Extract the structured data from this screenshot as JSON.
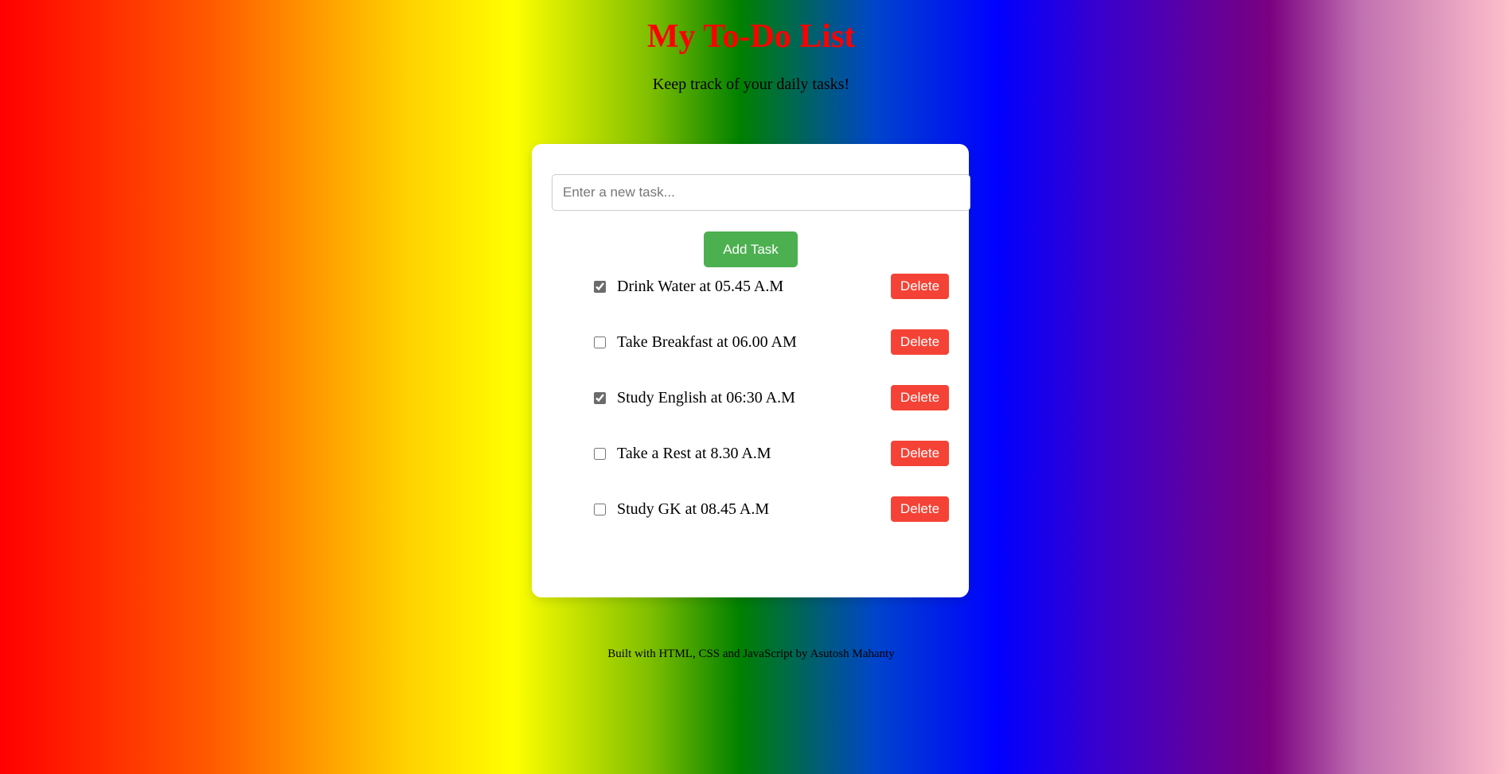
{
  "header": {
    "title": "My To-Do List",
    "subtitle": "Keep track of your daily tasks!"
  },
  "input": {
    "placeholder": "Enter a new task...",
    "value": ""
  },
  "add_button_label": "Add Task",
  "tasks": [
    {
      "text": "Drink Water at 05.45 A.M",
      "done": true,
      "delete_label": "Delete"
    },
    {
      "text": "Take Breakfast at 06.00 AM",
      "done": false,
      "delete_label": "Delete"
    },
    {
      "text": "Study English at 06:30 A.M",
      "done": true,
      "delete_label": "Delete"
    },
    {
      "text": "Take a Rest at 8.30 A.M",
      "done": false,
      "delete_label": "Delete"
    },
    {
      "text": "Study GK at 08.45 A.M",
      "done": false,
      "delete_label": "Delete"
    }
  ],
  "footer": {
    "text": "Built with HTML, CSS and JavaScript by Asutosh Mahanty"
  },
  "colors": {
    "title": "#ff0000",
    "add_button": "#4caf50",
    "delete_button": "#f44336"
  }
}
